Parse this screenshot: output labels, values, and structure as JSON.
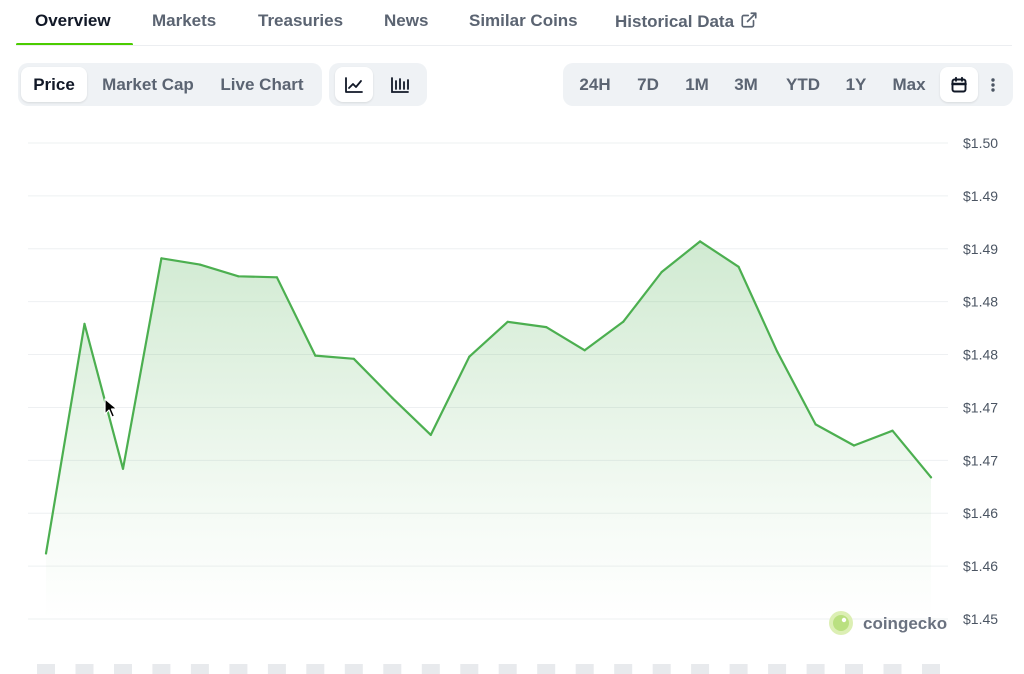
{
  "tabs": [
    {
      "label": "Overview",
      "active": true
    },
    {
      "label": "Markets"
    },
    {
      "label": "Treasuries"
    },
    {
      "label": "News"
    },
    {
      "label": "Similar Coins"
    },
    {
      "label": "Historical Data",
      "icon": "external-link-icon"
    }
  ],
  "chart_mode": {
    "options": [
      "Price",
      "Market Cap",
      "Live Chart"
    ],
    "selected": "Price"
  },
  "chart_style": {
    "icons": [
      "line-chart-icon",
      "candlestick-chart-icon"
    ],
    "selected": "line-chart-icon"
  },
  "ranges": {
    "options": [
      "24H",
      "7D",
      "1M",
      "3M",
      "YTD",
      "1Y",
      "Max"
    ],
    "extra_icons": [
      "calendar-icon",
      "more-vertical-icon"
    ]
  },
  "watermark": {
    "text": "coingecko",
    "icon": "coingecko-logo"
  },
  "colors": {
    "line": "#4caf50",
    "brand_green": "#4bcc00",
    "text_muted": "#5b6472"
  },
  "chart_data": {
    "type": "area",
    "y_tick_labels": [
      "$1.50",
      "$1.49",
      "$1.49",
      "$1.48",
      "$1.48",
      "$1.47",
      "$1.47",
      "$1.46",
      "$1.46",
      "$1.45"
    ],
    "ylim": [
      1.453,
      1.498
    ],
    "grid": true,
    "values": [
      1.4592,
      1.4809,
      1.4672,
      1.4871,
      1.4865,
      1.4854,
      1.4853,
      1.4779,
      1.4776,
      1.4739,
      1.4704,
      1.4778,
      1.4811,
      1.4806,
      1.4784,
      1.4811,
      1.4858,
      1.4887,
      1.4863,
      1.4783,
      1.4714,
      1.4694,
      1.4708,
      1.4664
    ]
  }
}
